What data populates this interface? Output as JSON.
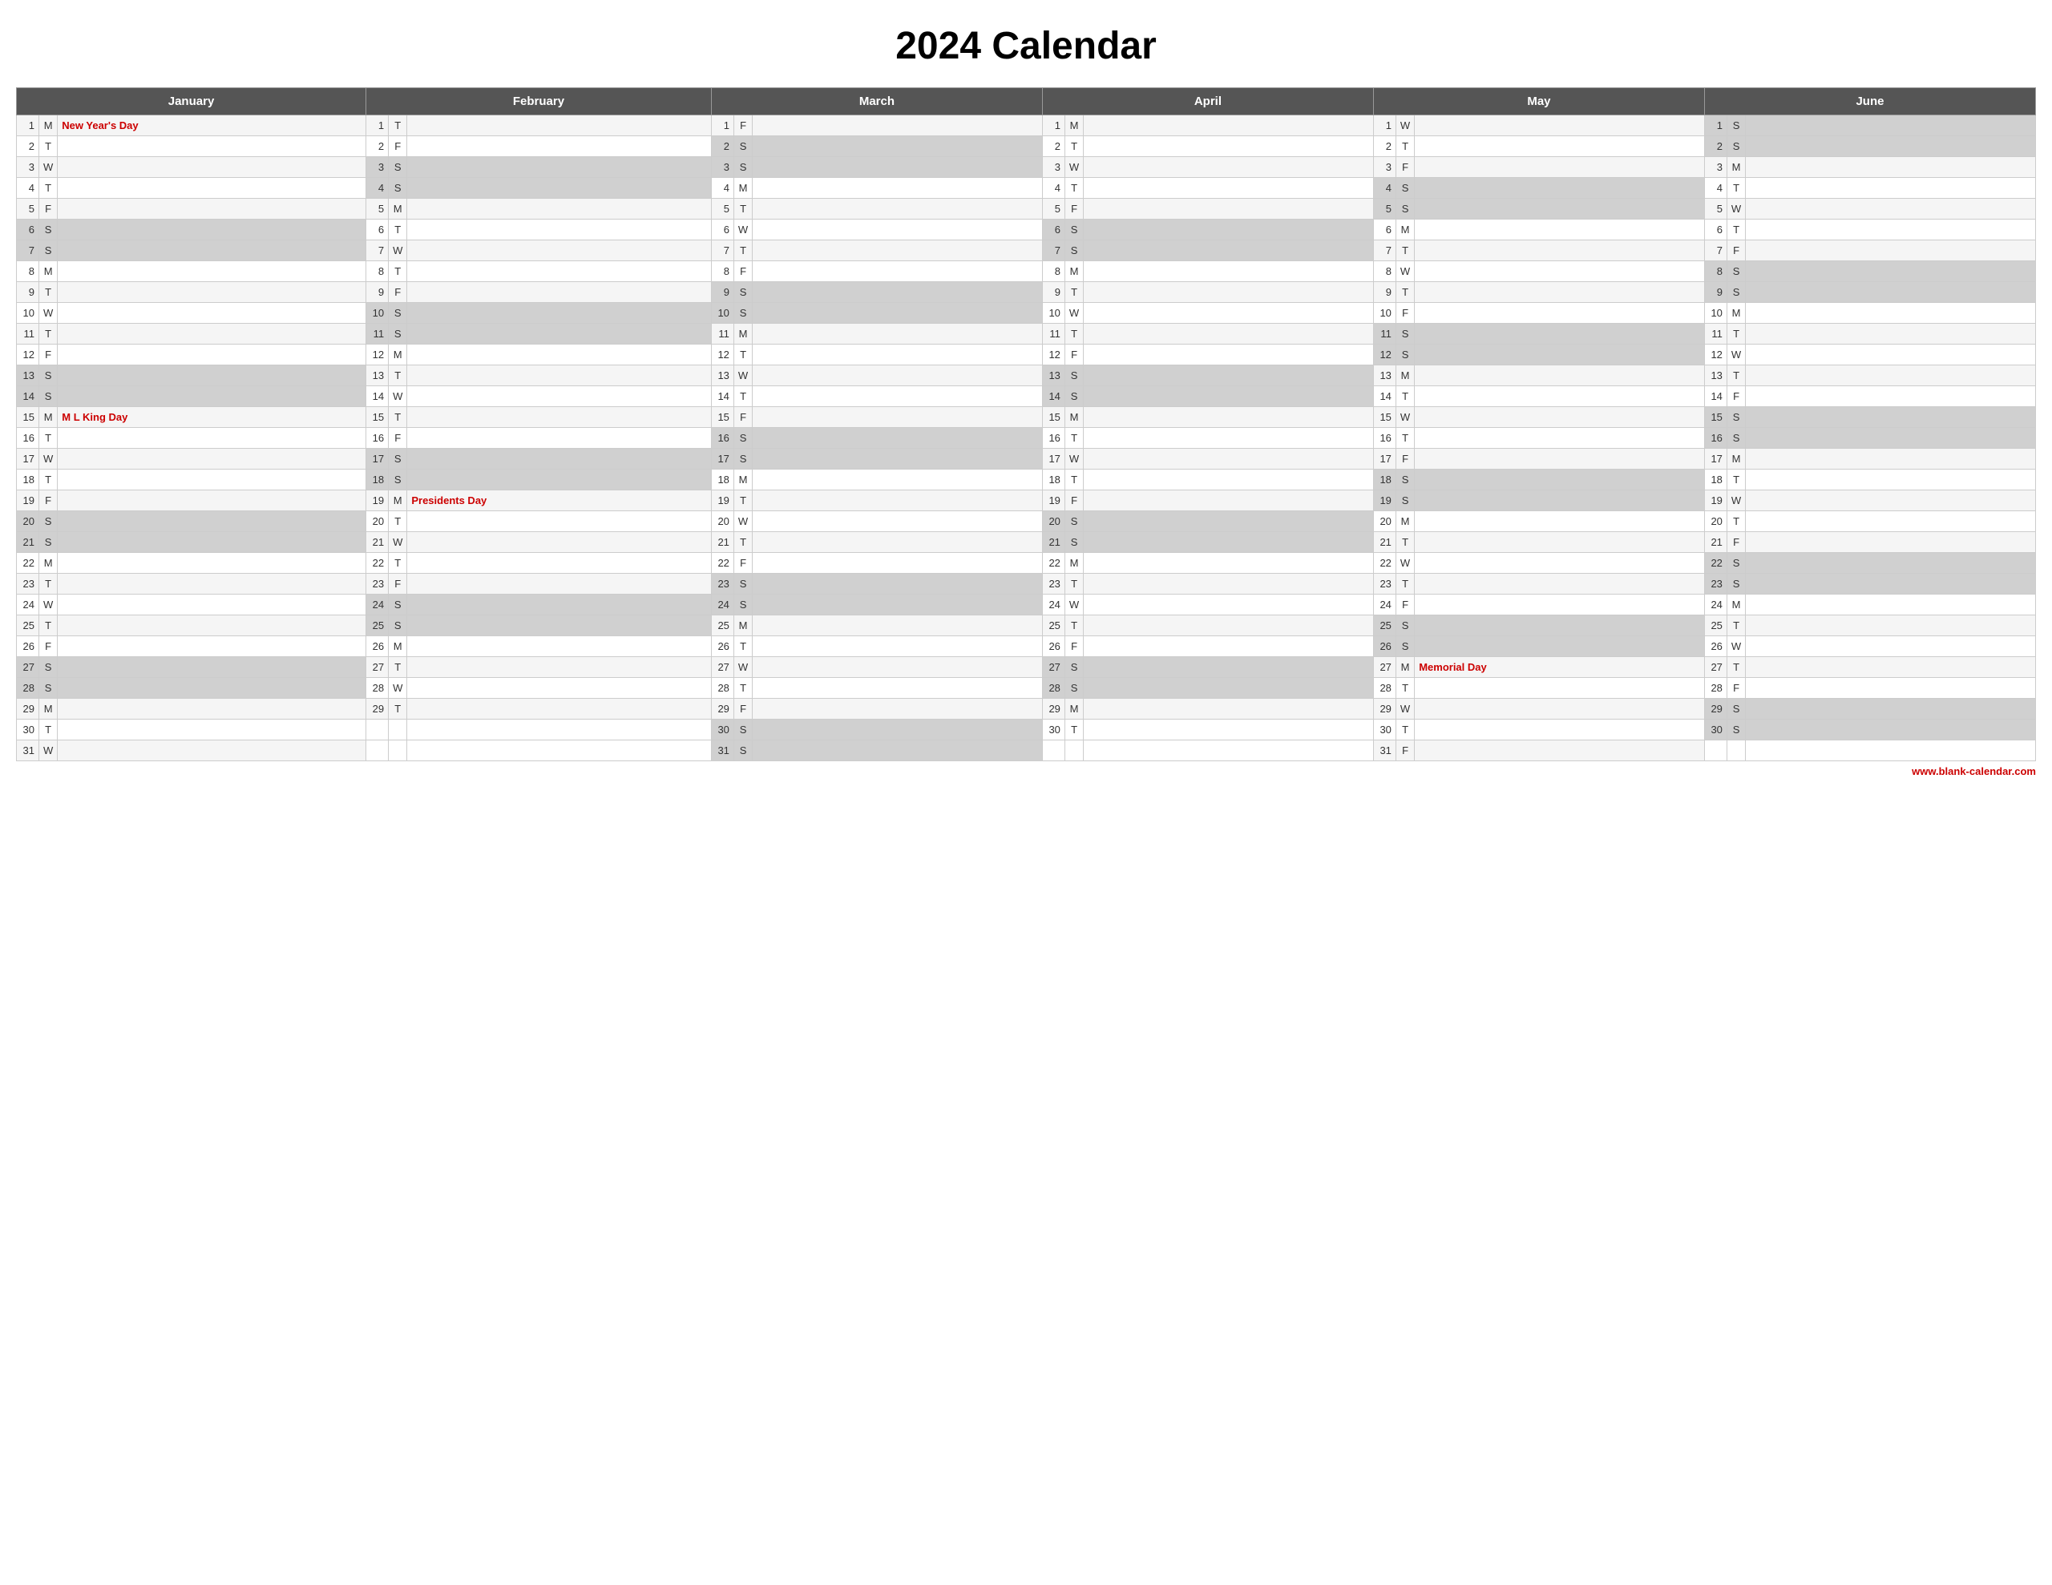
{
  "title": "2024 Calendar",
  "months": [
    "January",
    "February",
    "March",
    "April",
    "May",
    "June"
  ],
  "footer": "www.blank-calendar.com",
  "holidays": {
    "jan_1": "New Year's Day",
    "jan_15": "M L King Day",
    "feb_19": "Presidents Day",
    "may_27": "Memorial Day"
  },
  "rows": [
    {
      "d": 1,
      "jan": {
        "n": 1,
        "l": "M",
        "h": "New Year's Day"
      },
      "feb": {
        "n": 1,
        "l": "T",
        "h": ""
      },
      "mar": {
        "n": 1,
        "l": "F",
        "h": ""
      },
      "apr": {
        "n": 1,
        "l": "M",
        "h": ""
      },
      "may": {
        "n": 1,
        "l": "W",
        "h": ""
      },
      "jun": {
        "n": 1,
        "l": "S",
        "h": "",
        "w": true
      }
    },
    {
      "d": 2,
      "jan": {
        "n": 2,
        "l": "T",
        "h": ""
      },
      "feb": {
        "n": 2,
        "l": "F",
        "h": ""
      },
      "mar": {
        "n": 2,
        "l": "S",
        "h": "",
        "w": true
      },
      "apr": {
        "n": 2,
        "l": "T",
        "h": ""
      },
      "may": {
        "n": 2,
        "l": "T",
        "h": ""
      },
      "jun": {
        "n": 2,
        "l": "S",
        "h": "",
        "w": true
      }
    },
    {
      "d": 3,
      "jan": {
        "n": 3,
        "l": "W",
        "h": ""
      },
      "feb": {
        "n": 3,
        "l": "S",
        "h": "",
        "w": true
      },
      "mar": {
        "n": 3,
        "l": "S",
        "h": "",
        "w": true
      },
      "apr": {
        "n": 3,
        "l": "W",
        "h": ""
      },
      "may": {
        "n": 3,
        "l": "F",
        "h": ""
      },
      "jun": {
        "n": 3,
        "l": "M",
        "h": ""
      }
    },
    {
      "d": 4,
      "jan": {
        "n": 4,
        "l": "T",
        "h": ""
      },
      "feb": {
        "n": 4,
        "l": "S",
        "h": "",
        "w": true
      },
      "mar": {
        "n": 4,
        "l": "M",
        "h": ""
      },
      "apr": {
        "n": 4,
        "l": "T",
        "h": ""
      },
      "may": {
        "n": 4,
        "l": "S",
        "h": "",
        "w": true
      },
      "jun": {
        "n": 4,
        "l": "T",
        "h": ""
      }
    },
    {
      "d": 5,
      "jan": {
        "n": 5,
        "l": "F",
        "h": ""
      },
      "feb": {
        "n": 5,
        "l": "M",
        "h": ""
      },
      "mar": {
        "n": 5,
        "l": "T",
        "h": ""
      },
      "apr": {
        "n": 5,
        "l": "F",
        "h": ""
      },
      "may": {
        "n": 5,
        "l": "S",
        "h": "",
        "w": true
      },
      "jun": {
        "n": 5,
        "l": "W",
        "h": ""
      }
    },
    {
      "d": 6,
      "jan": {
        "n": 6,
        "l": "S",
        "h": "",
        "w": true
      },
      "feb": {
        "n": 6,
        "l": "T",
        "h": ""
      },
      "mar": {
        "n": 6,
        "l": "W",
        "h": ""
      },
      "apr": {
        "n": 6,
        "l": "S",
        "h": "",
        "w": true
      },
      "may": {
        "n": 6,
        "l": "M",
        "h": ""
      },
      "jun": {
        "n": 6,
        "l": "T",
        "h": ""
      }
    },
    {
      "d": 7,
      "jan": {
        "n": 7,
        "l": "S",
        "h": "",
        "w": true
      },
      "feb": {
        "n": 7,
        "l": "W",
        "h": ""
      },
      "mar": {
        "n": 7,
        "l": "T",
        "h": ""
      },
      "apr": {
        "n": 7,
        "l": "S",
        "h": "",
        "w": true
      },
      "may": {
        "n": 7,
        "l": "T",
        "h": ""
      },
      "jun": {
        "n": 7,
        "l": "F",
        "h": ""
      }
    },
    {
      "d": 8,
      "jan": {
        "n": 8,
        "l": "M",
        "h": ""
      },
      "feb": {
        "n": 8,
        "l": "T",
        "h": ""
      },
      "mar": {
        "n": 8,
        "l": "F",
        "h": ""
      },
      "apr": {
        "n": 8,
        "l": "M",
        "h": ""
      },
      "may": {
        "n": 8,
        "l": "W",
        "h": ""
      },
      "jun": {
        "n": 8,
        "l": "S",
        "h": "",
        "w": true
      }
    },
    {
      "d": 9,
      "jan": {
        "n": 9,
        "l": "T",
        "h": ""
      },
      "feb": {
        "n": 9,
        "l": "F",
        "h": ""
      },
      "mar": {
        "n": 9,
        "l": "S",
        "h": "",
        "w": true
      },
      "apr": {
        "n": 9,
        "l": "T",
        "h": ""
      },
      "may": {
        "n": 9,
        "l": "T",
        "h": ""
      },
      "jun": {
        "n": 9,
        "l": "S",
        "h": "",
        "w": true
      }
    },
    {
      "d": 10,
      "jan": {
        "n": 10,
        "l": "W",
        "h": ""
      },
      "feb": {
        "n": 10,
        "l": "S",
        "h": "",
        "w": true
      },
      "mar": {
        "n": 10,
        "l": "S",
        "h": "",
        "w": true
      },
      "apr": {
        "n": 10,
        "l": "W",
        "h": ""
      },
      "may": {
        "n": 10,
        "l": "F",
        "h": ""
      },
      "jun": {
        "n": 10,
        "l": "M",
        "h": ""
      }
    },
    {
      "d": 11,
      "jan": {
        "n": 11,
        "l": "T",
        "h": ""
      },
      "feb": {
        "n": 11,
        "l": "S",
        "h": "",
        "w": true
      },
      "mar": {
        "n": 11,
        "l": "M",
        "h": ""
      },
      "apr": {
        "n": 11,
        "l": "T",
        "h": ""
      },
      "may": {
        "n": 11,
        "l": "S",
        "h": "",
        "w": true
      },
      "jun": {
        "n": 11,
        "l": "T",
        "h": ""
      }
    },
    {
      "d": 12,
      "jan": {
        "n": 12,
        "l": "F",
        "h": ""
      },
      "feb": {
        "n": 12,
        "l": "M",
        "h": ""
      },
      "mar": {
        "n": 12,
        "l": "T",
        "h": ""
      },
      "apr": {
        "n": 12,
        "l": "F",
        "h": ""
      },
      "may": {
        "n": 12,
        "l": "S",
        "h": "",
        "w": true
      },
      "jun": {
        "n": 12,
        "l": "W",
        "h": ""
      }
    },
    {
      "d": 13,
      "jan": {
        "n": 13,
        "l": "S",
        "h": "",
        "w": true
      },
      "feb": {
        "n": 13,
        "l": "T",
        "h": ""
      },
      "mar": {
        "n": 13,
        "l": "W",
        "h": ""
      },
      "apr": {
        "n": 13,
        "l": "S",
        "h": "",
        "w": true
      },
      "may": {
        "n": 13,
        "l": "M",
        "h": ""
      },
      "jun": {
        "n": 13,
        "l": "T",
        "h": ""
      }
    },
    {
      "d": 14,
      "jan": {
        "n": 14,
        "l": "S",
        "h": "",
        "w": true
      },
      "feb": {
        "n": 14,
        "l": "W",
        "h": ""
      },
      "mar": {
        "n": 14,
        "l": "T",
        "h": ""
      },
      "apr": {
        "n": 14,
        "l": "S",
        "h": "",
        "w": true
      },
      "may": {
        "n": 14,
        "l": "T",
        "h": ""
      },
      "jun": {
        "n": 14,
        "l": "F",
        "h": ""
      }
    },
    {
      "d": 15,
      "jan": {
        "n": 15,
        "l": "M",
        "h": "M L King Day"
      },
      "feb": {
        "n": 15,
        "l": "T",
        "h": ""
      },
      "mar": {
        "n": 15,
        "l": "F",
        "h": ""
      },
      "apr": {
        "n": 15,
        "l": "M",
        "h": ""
      },
      "may": {
        "n": 15,
        "l": "W",
        "h": ""
      },
      "jun": {
        "n": 15,
        "l": "S",
        "h": "",
        "w": true
      }
    },
    {
      "d": 16,
      "jan": {
        "n": 16,
        "l": "T",
        "h": ""
      },
      "feb": {
        "n": 16,
        "l": "F",
        "h": ""
      },
      "mar": {
        "n": 16,
        "l": "S",
        "h": "",
        "w": true
      },
      "apr": {
        "n": 16,
        "l": "T",
        "h": ""
      },
      "may": {
        "n": 16,
        "l": "T",
        "h": ""
      },
      "jun": {
        "n": 16,
        "l": "S",
        "h": "",
        "w": true
      }
    },
    {
      "d": 17,
      "jan": {
        "n": 17,
        "l": "W",
        "h": ""
      },
      "feb": {
        "n": 17,
        "l": "S",
        "h": "",
        "w": true
      },
      "mar": {
        "n": 17,
        "l": "S",
        "h": "",
        "w": true
      },
      "apr": {
        "n": 17,
        "l": "W",
        "h": ""
      },
      "may": {
        "n": 17,
        "l": "F",
        "h": ""
      },
      "jun": {
        "n": 17,
        "l": "M",
        "h": ""
      }
    },
    {
      "d": 18,
      "jan": {
        "n": 18,
        "l": "T",
        "h": ""
      },
      "feb": {
        "n": 18,
        "l": "S",
        "h": "",
        "w": true
      },
      "mar": {
        "n": 18,
        "l": "M",
        "h": ""
      },
      "apr": {
        "n": 18,
        "l": "T",
        "h": ""
      },
      "may": {
        "n": 18,
        "l": "S",
        "h": "",
        "w": true
      },
      "jun": {
        "n": 18,
        "l": "T",
        "h": ""
      }
    },
    {
      "d": 19,
      "jan": {
        "n": 19,
        "l": "F",
        "h": ""
      },
      "feb": {
        "n": 19,
        "l": "M",
        "h": "Presidents Day"
      },
      "mar": {
        "n": 19,
        "l": "T",
        "h": ""
      },
      "apr": {
        "n": 19,
        "l": "F",
        "h": ""
      },
      "may": {
        "n": 19,
        "l": "S",
        "h": "",
        "w": true
      },
      "jun": {
        "n": 19,
        "l": "W",
        "h": ""
      }
    },
    {
      "d": 20,
      "jan": {
        "n": 20,
        "l": "S",
        "h": "",
        "w": true
      },
      "feb": {
        "n": 20,
        "l": "T",
        "h": ""
      },
      "mar": {
        "n": 20,
        "l": "W",
        "h": ""
      },
      "apr": {
        "n": 20,
        "l": "S",
        "h": "",
        "w": true
      },
      "may": {
        "n": 20,
        "l": "M",
        "h": ""
      },
      "jun": {
        "n": 20,
        "l": "T",
        "h": ""
      }
    },
    {
      "d": 21,
      "jan": {
        "n": 21,
        "l": "S",
        "h": "",
        "w": true
      },
      "feb": {
        "n": 21,
        "l": "W",
        "h": ""
      },
      "mar": {
        "n": 21,
        "l": "T",
        "h": ""
      },
      "apr": {
        "n": 21,
        "l": "S",
        "h": "",
        "w": true
      },
      "may": {
        "n": 21,
        "l": "T",
        "h": ""
      },
      "jun": {
        "n": 21,
        "l": "F",
        "h": ""
      }
    },
    {
      "d": 22,
      "jan": {
        "n": 22,
        "l": "M",
        "h": ""
      },
      "feb": {
        "n": 22,
        "l": "T",
        "h": ""
      },
      "mar": {
        "n": 22,
        "l": "F",
        "h": ""
      },
      "apr": {
        "n": 22,
        "l": "M",
        "h": ""
      },
      "may": {
        "n": 22,
        "l": "W",
        "h": ""
      },
      "jun": {
        "n": 22,
        "l": "S",
        "h": "",
        "w": true
      }
    },
    {
      "d": 23,
      "jan": {
        "n": 23,
        "l": "T",
        "h": ""
      },
      "feb": {
        "n": 23,
        "l": "F",
        "h": ""
      },
      "mar": {
        "n": 23,
        "l": "S",
        "h": "",
        "w": true
      },
      "apr": {
        "n": 23,
        "l": "T",
        "h": ""
      },
      "may": {
        "n": 23,
        "l": "T",
        "h": ""
      },
      "jun": {
        "n": 23,
        "l": "S",
        "h": "",
        "w": true
      }
    },
    {
      "d": 24,
      "jan": {
        "n": 24,
        "l": "W",
        "h": ""
      },
      "feb": {
        "n": 24,
        "l": "S",
        "h": "",
        "w": true
      },
      "mar": {
        "n": 24,
        "l": "S",
        "h": "",
        "w": true
      },
      "apr": {
        "n": 24,
        "l": "W",
        "h": ""
      },
      "may": {
        "n": 24,
        "l": "F",
        "h": ""
      },
      "jun": {
        "n": 24,
        "l": "M",
        "h": ""
      }
    },
    {
      "d": 25,
      "jan": {
        "n": 25,
        "l": "T",
        "h": ""
      },
      "feb": {
        "n": 25,
        "l": "S",
        "h": "",
        "w": true
      },
      "mar": {
        "n": 25,
        "l": "M",
        "h": ""
      },
      "apr": {
        "n": 25,
        "l": "T",
        "h": ""
      },
      "may": {
        "n": 25,
        "l": "S",
        "h": "",
        "w": true
      },
      "jun": {
        "n": 25,
        "l": "T",
        "h": ""
      }
    },
    {
      "d": 26,
      "jan": {
        "n": 26,
        "l": "F",
        "h": ""
      },
      "feb": {
        "n": 26,
        "l": "M",
        "h": ""
      },
      "mar": {
        "n": 26,
        "l": "T",
        "h": ""
      },
      "apr": {
        "n": 26,
        "l": "F",
        "h": ""
      },
      "may": {
        "n": 26,
        "l": "S",
        "h": "",
        "w": true
      },
      "jun": {
        "n": 26,
        "l": "W",
        "h": ""
      }
    },
    {
      "d": 27,
      "jan": {
        "n": 27,
        "l": "S",
        "h": "",
        "w": true
      },
      "feb": {
        "n": 27,
        "l": "T",
        "h": ""
      },
      "mar": {
        "n": 27,
        "l": "W",
        "h": ""
      },
      "apr": {
        "n": 27,
        "l": "S",
        "h": "",
        "w": true
      },
      "may": {
        "n": 27,
        "l": "M",
        "h": "Memorial Day"
      },
      "jun": {
        "n": 27,
        "l": "T",
        "h": ""
      }
    },
    {
      "d": 28,
      "jan": {
        "n": 28,
        "l": "S",
        "h": "",
        "w": true
      },
      "feb": {
        "n": 28,
        "l": "W",
        "h": ""
      },
      "mar": {
        "n": 28,
        "l": "T",
        "h": ""
      },
      "apr": {
        "n": 28,
        "l": "S",
        "h": "",
        "w": true
      },
      "may": {
        "n": 28,
        "l": "T",
        "h": ""
      },
      "jun": {
        "n": 28,
        "l": "F",
        "h": ""
      }
    },
    {
      "d": 29,
      "jan": {
        "n": 29,
        "l": "M",
        "h": ""
      },
      "feb": {
        "n": 29,
        "l": "T",
        "h": ""
      },
      "mar": {
        "n": 29,
        "l": "F",
        "h": ""
      },
      "apr": {
        "n": 29,
        "l": "M",
        "h": ""
      },
      "may": {
        "n": 29,
        "l": "W",
        "h": ""
      },
      "jun": {
        "n": 29,
        "l": "S",
        "h": "",
        "w": true
      }
    },
    {
      "d": 30,
      "jan": {
        "n": 30,
        "l": "T",
        "h": ""
      },
      "feb": null,
      "mar": {
        "n": 30,
        "l": "S",
        "h": "",
        "w": true
      },
      "apr": {
        "n": 30,
        "l": "T",
        "h": ""
      },
      "may": {
        "n": 30,
        "l": "T",
        "h": ""
      },
      "jun": {
        "n": 30,
        "l": "S",
        "h": "",
        "w": true
      }
    },
    {
      "d": 31,
      "jan": {
        "n": 31,
        "l": "W",
        "h": ""
      },
      "feb": null,
      "mar": {
        "n": 31,
        "l": "S",
        "h": "",
        "w": true
      },
      "apr": null,
      "may": {
        "n": 31,
        "l": "F",
        "h": ""
      },
      "jun": null
    }
  ]
}
